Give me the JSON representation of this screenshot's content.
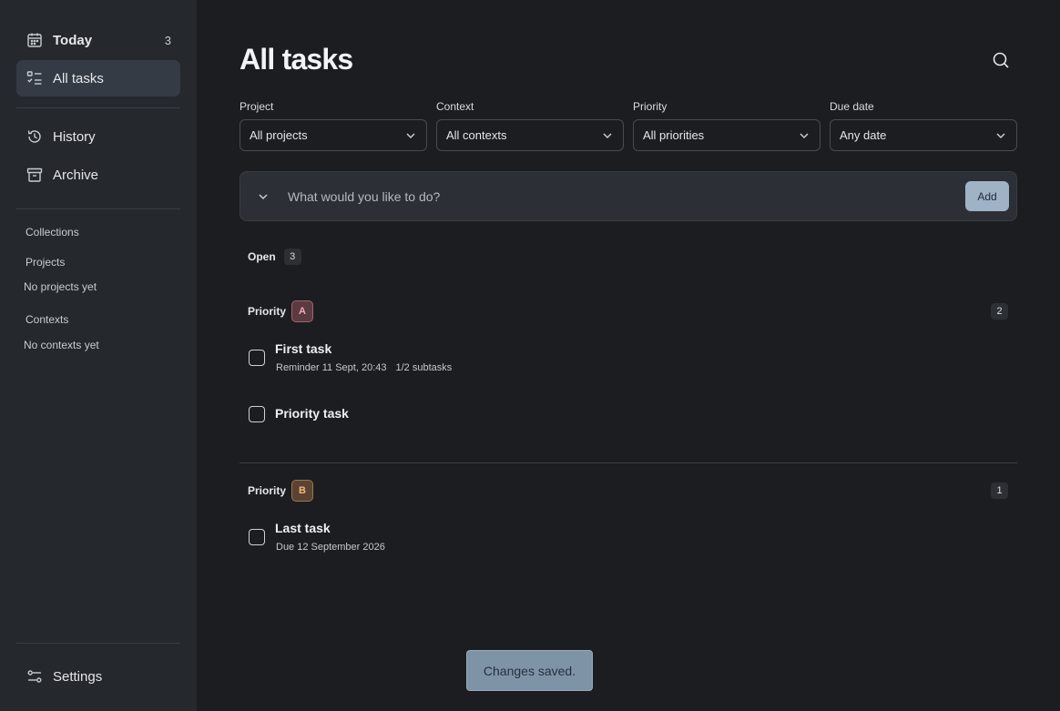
{
  "sidebar": {
    "today": {
      "label": "Today",
      "count": "3"
    },
    "all_tasks": {
      "label": "All tasks"
    },
    "history": {
      "label": "History"
    },
    "archive": {
      "label": "Archive"
    },
    "collections_label": "Collections",
    "projects_label": "Projects",
    "projects_empty": "No projects yet",
    "contexts_label": "Contexts",
    "contexts_empty": "No contexts yet",
    "settings": {
      "label": "Settings"
    }
  },
  "header": {
    "title": "All tasks"
  },
  "filters": [
    {
      "label": "Project",
      "value": "All projects"
    },
    {
      "label": "Context",
      "value": "All contexts"
    },
    {
      "label": "Priority",
      "value": "All priorities"
    },
    {
      "label": "Due date",
      "value": "Any date"
    }
  ],
  "composer": {
    "placeholder": "What would you like to do?",
    "add_label": "Add"
  },
  "open": {
    "label": "Open",
    "count": "3"
  },
  "groups": [
    {
      "label": "Priority",
      "badge": "A",
      "count": "2",
      "tasks": [
        {
          "title": "First task",
          "reminder": "Reminder 11 Sept, 20:43",
          "subtasks": "1/2 subtasks"
        },
        {
          "title": "Priority task"
        }
      ]
    },
    {
      "label": "Priority",
      "badge": "B",
      "count": "1",
      "tasks": [
        {
          "title": "Last task",
          "due": "Due 12 September 2026"
        }
      ]
    }
  ],
  "toast": {
    "message": "Changes saved."
  },
  "colors": {
    "background": "#1c1d20",
    "sidebar": "#25282d",
    "accent": "#9fb2c6",
    "priority_a": "#f2a9b6",
    "priority_b": "#f1b781"
  }
}
